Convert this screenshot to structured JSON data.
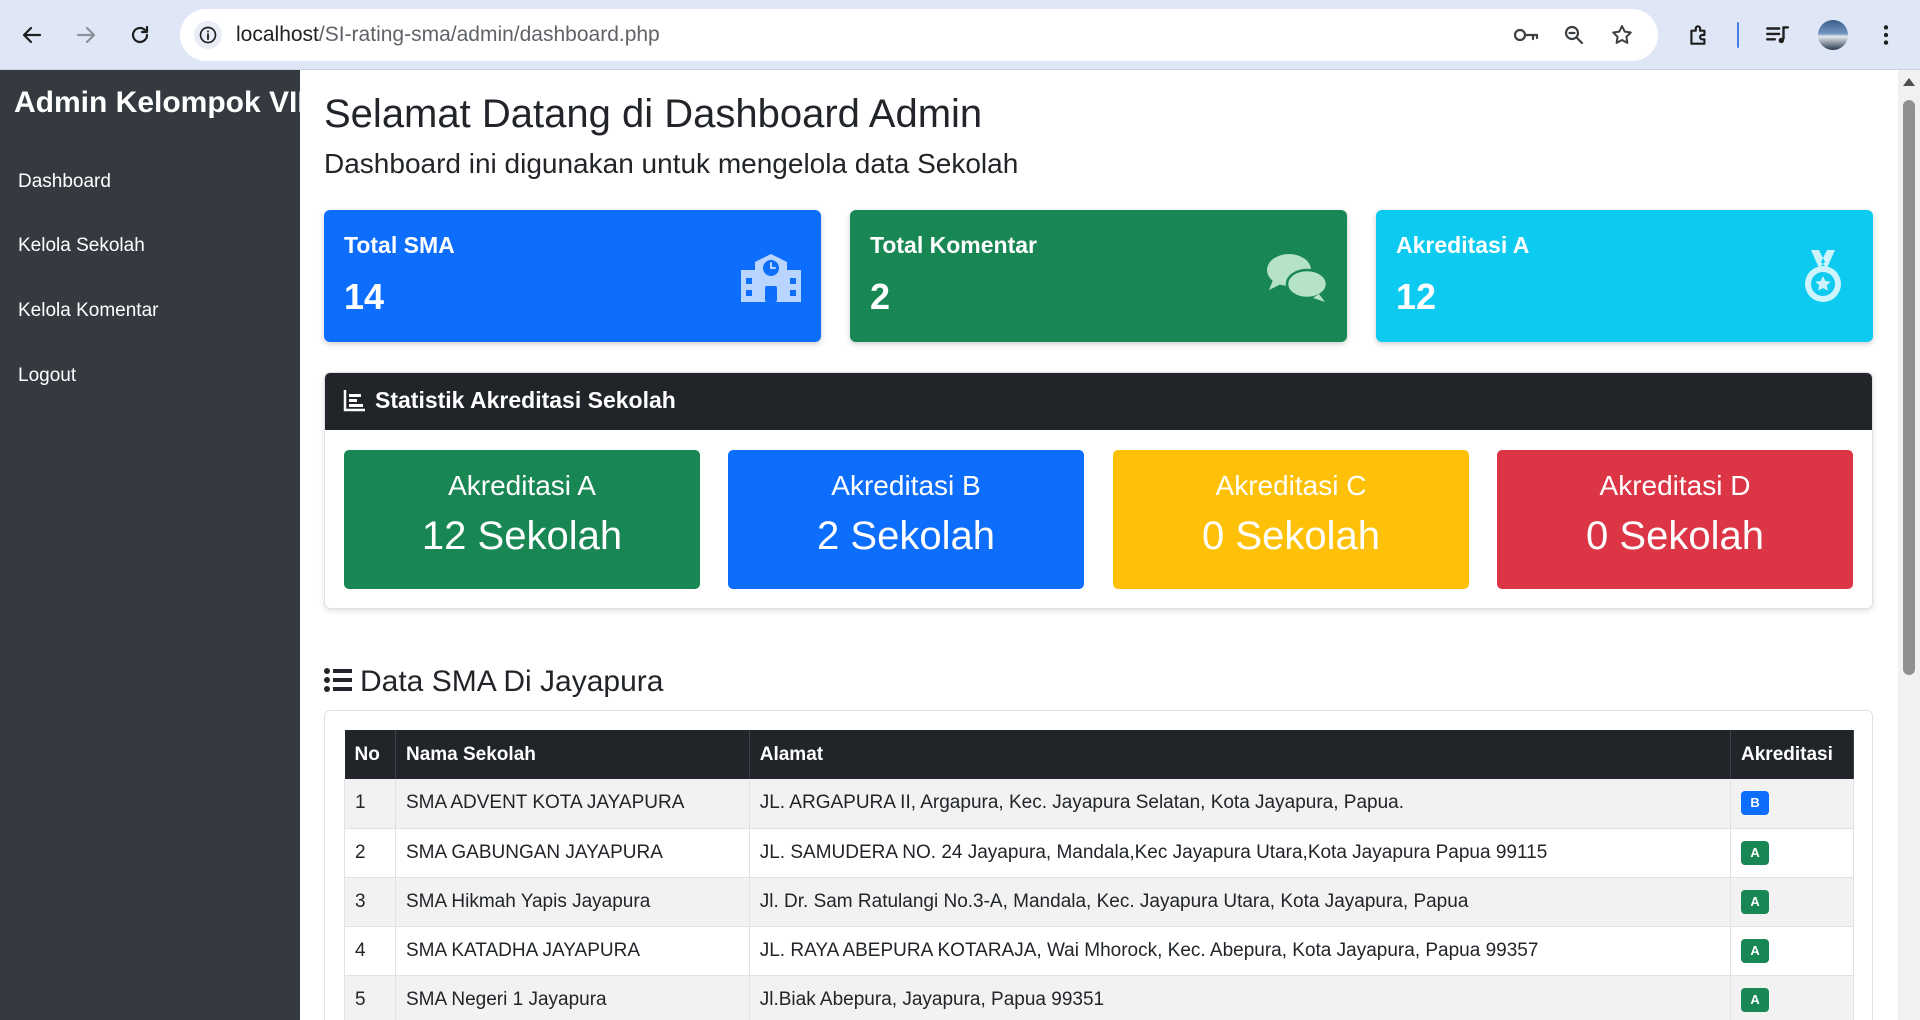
{
  "browser": {
    "url_host": "localhost",
    "url_path": "/SI-rating-sma/admin/dashboard.php"
  },
  "sidebar": {
    "brand": "Admin Kelompok VII",
    "items": [
      {
        "label": "Dashboard"
      },
      {
        "label": "Kelola Sekolah"
      },
      {
        "label": "Kelola Komentar"
      },
      {
        "label": "Logout"
      }
    ]
  },
  "header": {
    "title": "Selamat Datang di Dashboard Admin",
    "subtitle": "Dashboard ini digunakan untuk mengelola data Sekolah"
  },
  "cards": [
    {
      "title": "Total SMA",
      "value": "14",
      "color": "#0d6efd",
      "icon": "school-icon"
    },
    {
      "title": "Total Komentar",
      "value": "2",
      "color": "#198754",
      "icon": "comments-icon"
    },
    {
      "title": "Akreditasi A",
      "value": "12",
      "color": "#0dcaf0",
      "icon": "medal-icon"
    }
  ],
  "stats": {
    "title": "Statistik Akreditasi Sekolah",
    "boxes": [
      {
        "label": "Akreditasi A",
        "value": "12 Sekolah",
        "color": "#198754",
        "text_color": "#ffffff"
      },
      {
        "label": "Akreditasi B",
        "value": "2 Sekolah",
        "color": "#0d6efd",
        "text_color": "#ffffff"
      },
      {
        "label": "Akreditasi C",
        "value": "0 Sekolah",
        "color": "#ffc107",
        "text_color": "#ffffff"
      },
      {
        "label": "Akreditasi D",
        "value": "0 Sekolah",
        "color": "#dc3545",
        "text_color": "#ffffff"
      }
    ]
  },
  "table": {
    "title": "Data SMA Di Jayapura",
    "columns": [
      "No",
      "Nama Sekolah",
      "Alamat",
      "Akreditasi"
    ],
    "rows": [
      {
        "no": "1",
        "nama": "SMA ADVENT KOTA JAYAPURA",
        "alamat": "JL. ARGAPURA II, Argapura, Kec. Jayapura Selatan, Kota Jayapura, Papua.",
        "akreditasi": "B",
        "badge_color": "#0d6efd"
      },
      {
        "no": "2",
        "nama": "SMA GABUNGAN JAYAPURA",
        "alamat": "JL. SAMUDERA NO. 24 Jayapura, Mandala,Kec Jayapura Utara,Kota Jayapura Papua 99115",
        "akreditasi": "A",
        "badge_color": "#198754"
      },
      {
        "no": "3",
        "nama": "SMA Hikmah Yapis Jayapura",
        "alamat": "Jl. Dr. Sam Ratulangi No.3-A, Mandala, Kec. Jayapura Utara, Kota Jayapura, Papua",
        "akreditasi": "A",
        "badge_color": "#198754"
      },
      {
        "no": "4",
        "nama": "SMA KATADHA JAYAPURA",
        "alamat": "JL. RAYA ABEPURA KOTARAJA, Wai Mhorock, Kec. Abepura, Kota Jayapura, Papua 99357",
        "akreditasi": "A",
        "badge_color": "#198754"
      },
      {
        "no": "5",
        "nama": "SMA Negeri 1 Jayapura",
        "alamat": "Jl.Biak Abepura, Jayapura, Papua 99351",
        "akreditasi": "A",
        "badge_color": "#198754"
      }
    ]
  }
}
